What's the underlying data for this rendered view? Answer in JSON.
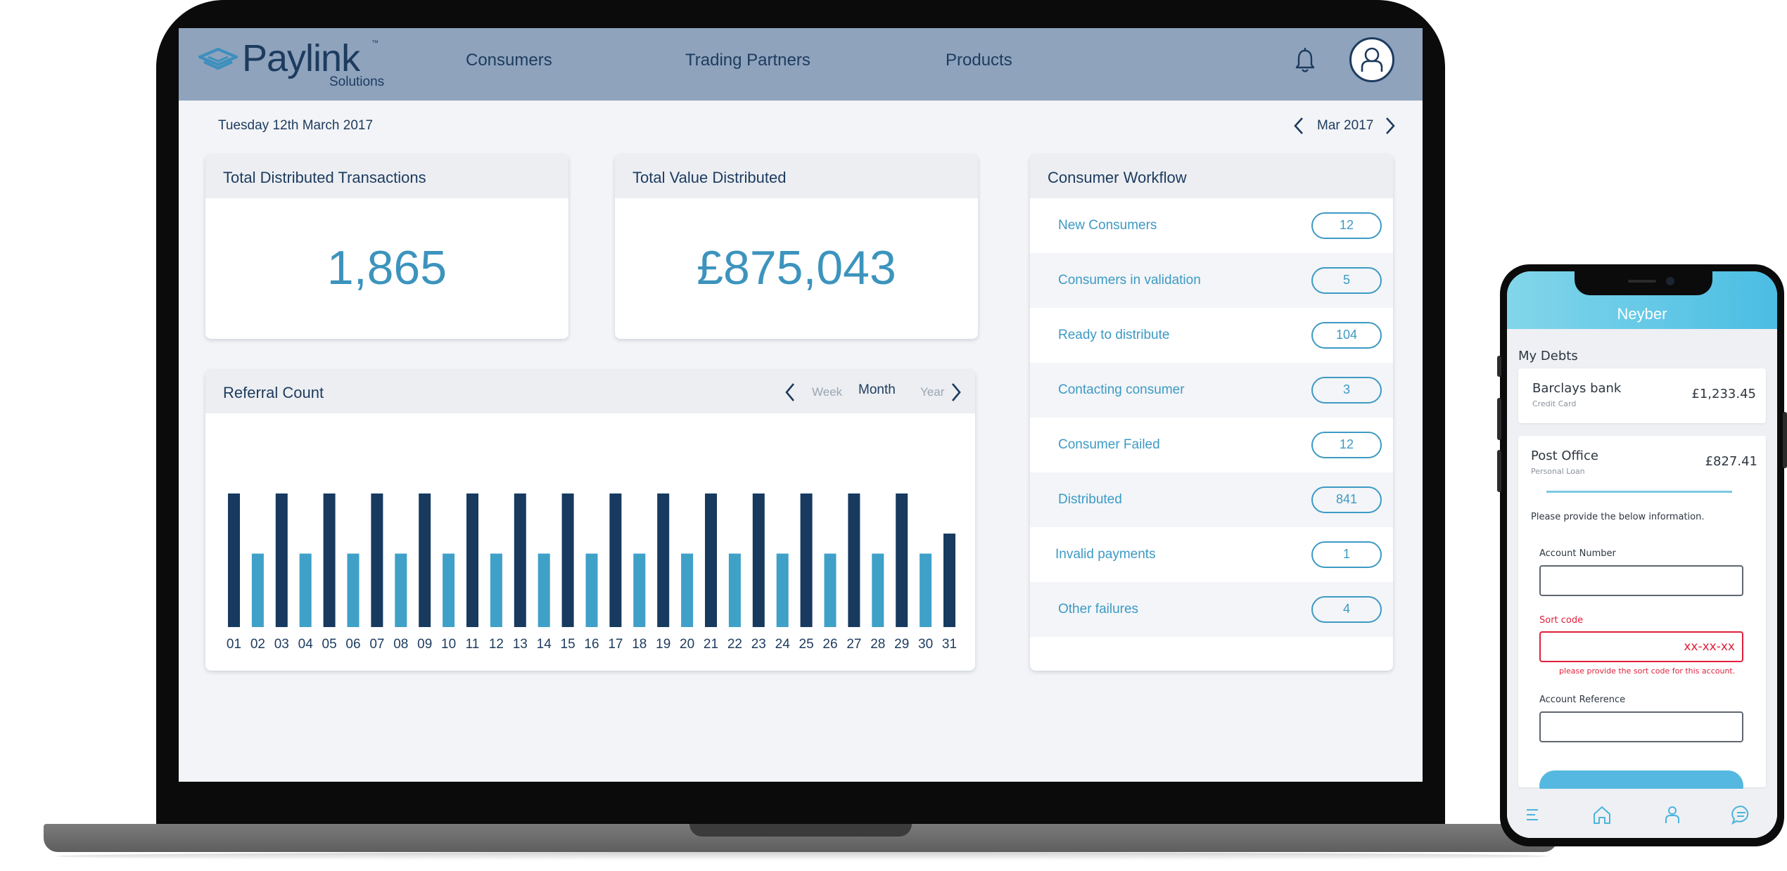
{
  "app": {
    "logo_word": "Paylink",
    "logo_sub": "Solutions",
    "logo_tm": "™"
  },
  "nav": {
    "consumers": "Consumers",
    "trading_partners": "Trading Partners",
    "products": "Products"
  },
  "icons": {
    "bell": "bell-icon",
    "profile": "user-avatar-icon",
    "prev": "chevron-left-icon",
    "next": "chevron-right-icon"
  },
  "header": {
    "date": "Tuesday 12th March 2017",
    "month": "Mar 2017"
  },
  "stats": {
    "transactions_title": "Total Distributed Transactions",
    "transactions_value": "1,865",
    "value_title": "Total Value Distributed",
    "value_value": "£875,043"
  },
  "workflow": {
    "title": "Consumer Workflow",
    "items": [
      {
        "label": "New Consumers",
        "count": "12"
      },
      {
        "label": "Consumers in validation",
        "count": "5"
      },
      {
        "label": "Ready to distribute",
        "count": "104"
      },
      {
        "label": "Contacting consumer",
        "count": "3"
      },
      {
        "label": "Consumer Failed",
        "count": "12"
      },
      {
        "label": "Distributed",
        "count": "841"
      },
      {
        "label": "Invalid payments",
        "count": "1"
      },
      {
        "label": "Other failures",
        "count": "4"
      }
    ]
  },
  "referral": {
    "title": "Referral Count",
    "periods": [
      "Week",
      "Month",
      "Year"
    ],
    "active_period": "Month"
  },
  "colors": {
    "dark_bar": "#173a5e",
    "light_bar": "#3fa0c8",
    "accent": "#3d9ac4",
    "navy": "#1d3b5e",
    "error": "#e0203b"
  },
  "chart_data": {
    "type": "bar",
    "categories": [
      "01",
      "02",
      "03",
      "04",
      "05",
      "06",
      "07",
      "08",
      "09",
      "10",
      "11",
      "12",
      "13",
      "14",
      "15",
      "16",
      "17",
      "18",
      "19",
      "20",
      "21",
      "22",
      "23",
      "24",
      "25",
      "26",
      "27",
      "28",
      "29",
      "30",
      "31"
    ],
    "values": [
      10,
      5.5,
      10,
      5.5,
      10,
      5.5,
      10,
      5.5,
      10,
      5.5,
      10,
      5.5,
      10,
      5.5,
      10,
      5.5,
      10,
      5.5,
      10,
      5.5,
      10,
      5.5,
      10,
      5.5,
      10,
      5.5,
      10,
      5.5,
      10,
      5.5,
      7
    ],
    "ylim": [
      0,
      10
    ],
    "grid": false,
    "title": "Referral Count"
  },
  "phone": {
    "app_title": "Neyber",
    "section": "My Debts",
    "debts": [
      {
        "name": "Barclays bank",
        "type": "Credit Card",
        "amount": "£1,233.45"
      },
      {
        "name": "Post Office",
        "type": "Personal Loan",
        "amount": "£827.41"
      }
    ],
    "info_text": "Please provide the below information.",
    "account_number_label": "Account Number",
    "sort_code_label": "Sort code",
    "sort_code_value": "xx-xx-xx",
    "sort_code_error": "please provide the sort code for this account.",
    "account_reference_label": "Account Reference",
    "tabs": [
      "menu-icon",
      "home-icon",
      "profile-icon",
      "chat-icon"
    ]
  }
}
